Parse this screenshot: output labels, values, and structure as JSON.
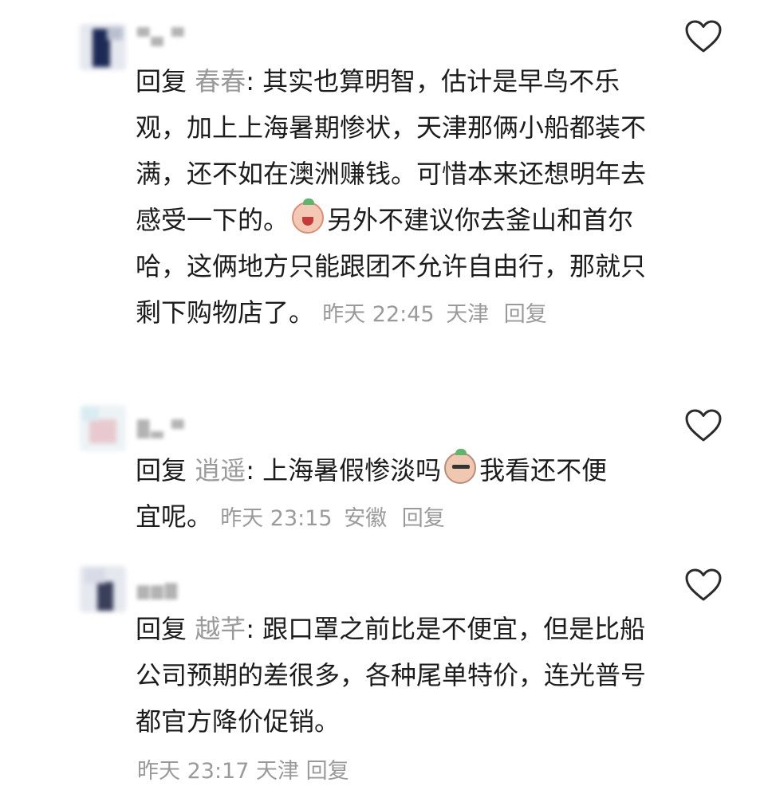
{
  "comments": [
    {
      "reply_prefix": "回复",
      "target_name": "春春",
      "separator": ":",
      "text_before_emoji": " 其实也算明智，估计是早鸟不乐观，加上上海暑期惨状，天津那俩小船都装不满，还不如在澳洲赚钱。可惜本来还想明年去感受一下的。",
      "emoji_icon": "crying-face-emoji",
      "text_after_emoji": "另外不建议你去釜山和首尔哈，这俩地方只能跟团不允许自由行，那就只剩下购物店了。",
      "time": "昨天 22:45",
      "location": "天津",
      "reply_label": "回复"
    },
    {
      "reply_prefix": "回复",
      "target_name": "逍遥",
      "separator": ":",
      "text_before_emoji": " 上海暑假惨淡吗",
      "emoji_icon": "sunglasses-face-emoji",
      "text_after_emoji": "我看还不便宜呢。",
      "time": "昨天 23:15",
      "location": "安徽",
      "reply_label": "回复"
    },
    {
      "reply_prefix": "回复",
      "target_name": "越芊",
      "separator": ":",
      "text": " 跟口罩之前比是不便宜，但是比船公司预期的差很多，各种尾单特价，连光普号都官方降价促销。",
      "time": "昨天 23:17",
      "location": "天津",
      "reply_label": "回复"
    }
  ],
  "colors": {
    "text": "#1c1c1c",
    "muted": "#9a9a9a",
    "heart_stroke": "#2b2b2b"
  },
  "icons": {
    "like": "heart-outline-icon"
  }
}
